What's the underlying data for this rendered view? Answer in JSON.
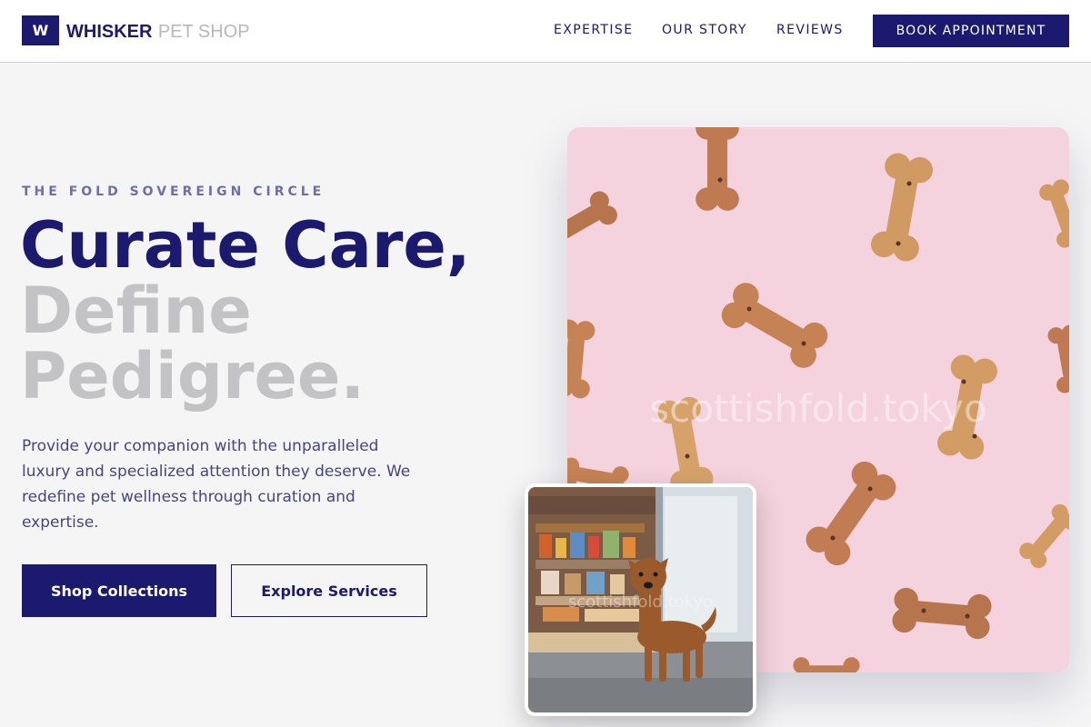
{
  "header": {
    "logo_letter": "W",
    "brand_strong": "WHISKER",
    "brand_light": "PET SHOP",
    "nav": [
      {
        "label": "EXPERTISE"
      },
      {
        "label": "OUR STORY"
      },
      {
        "label": "REVIEWS"
      }
    ],
    "cta_label": "BOOK APPOINTMENT"
  },
  "hero": {
    "eyebrow": "THE FOLD SOVEREIGN CIRCLE",
    "headline_line1": "Curate Care,",
    "headline_line2": "Define",
    "headline_line3": "Pedigree.",
    "lead": "Provide your companion with the unparalleled luxury and specialized attention they deserve. We redefine pet wellness through curation and expertise.",
    "primary_button": "Shop Collections",
    "secondary_button": "Explore Services"
  },
  "images": {
    "main_watermark": "scottishfold.tokyo",
    "inset_watermark": "scottishfold.tokyo"
  },
  "colors": {
    "brand_navy": "#1b1a6e",
    "muted_grey": "#c3c3c5",
    "pink_background": "#f4d2de"
  }
}
